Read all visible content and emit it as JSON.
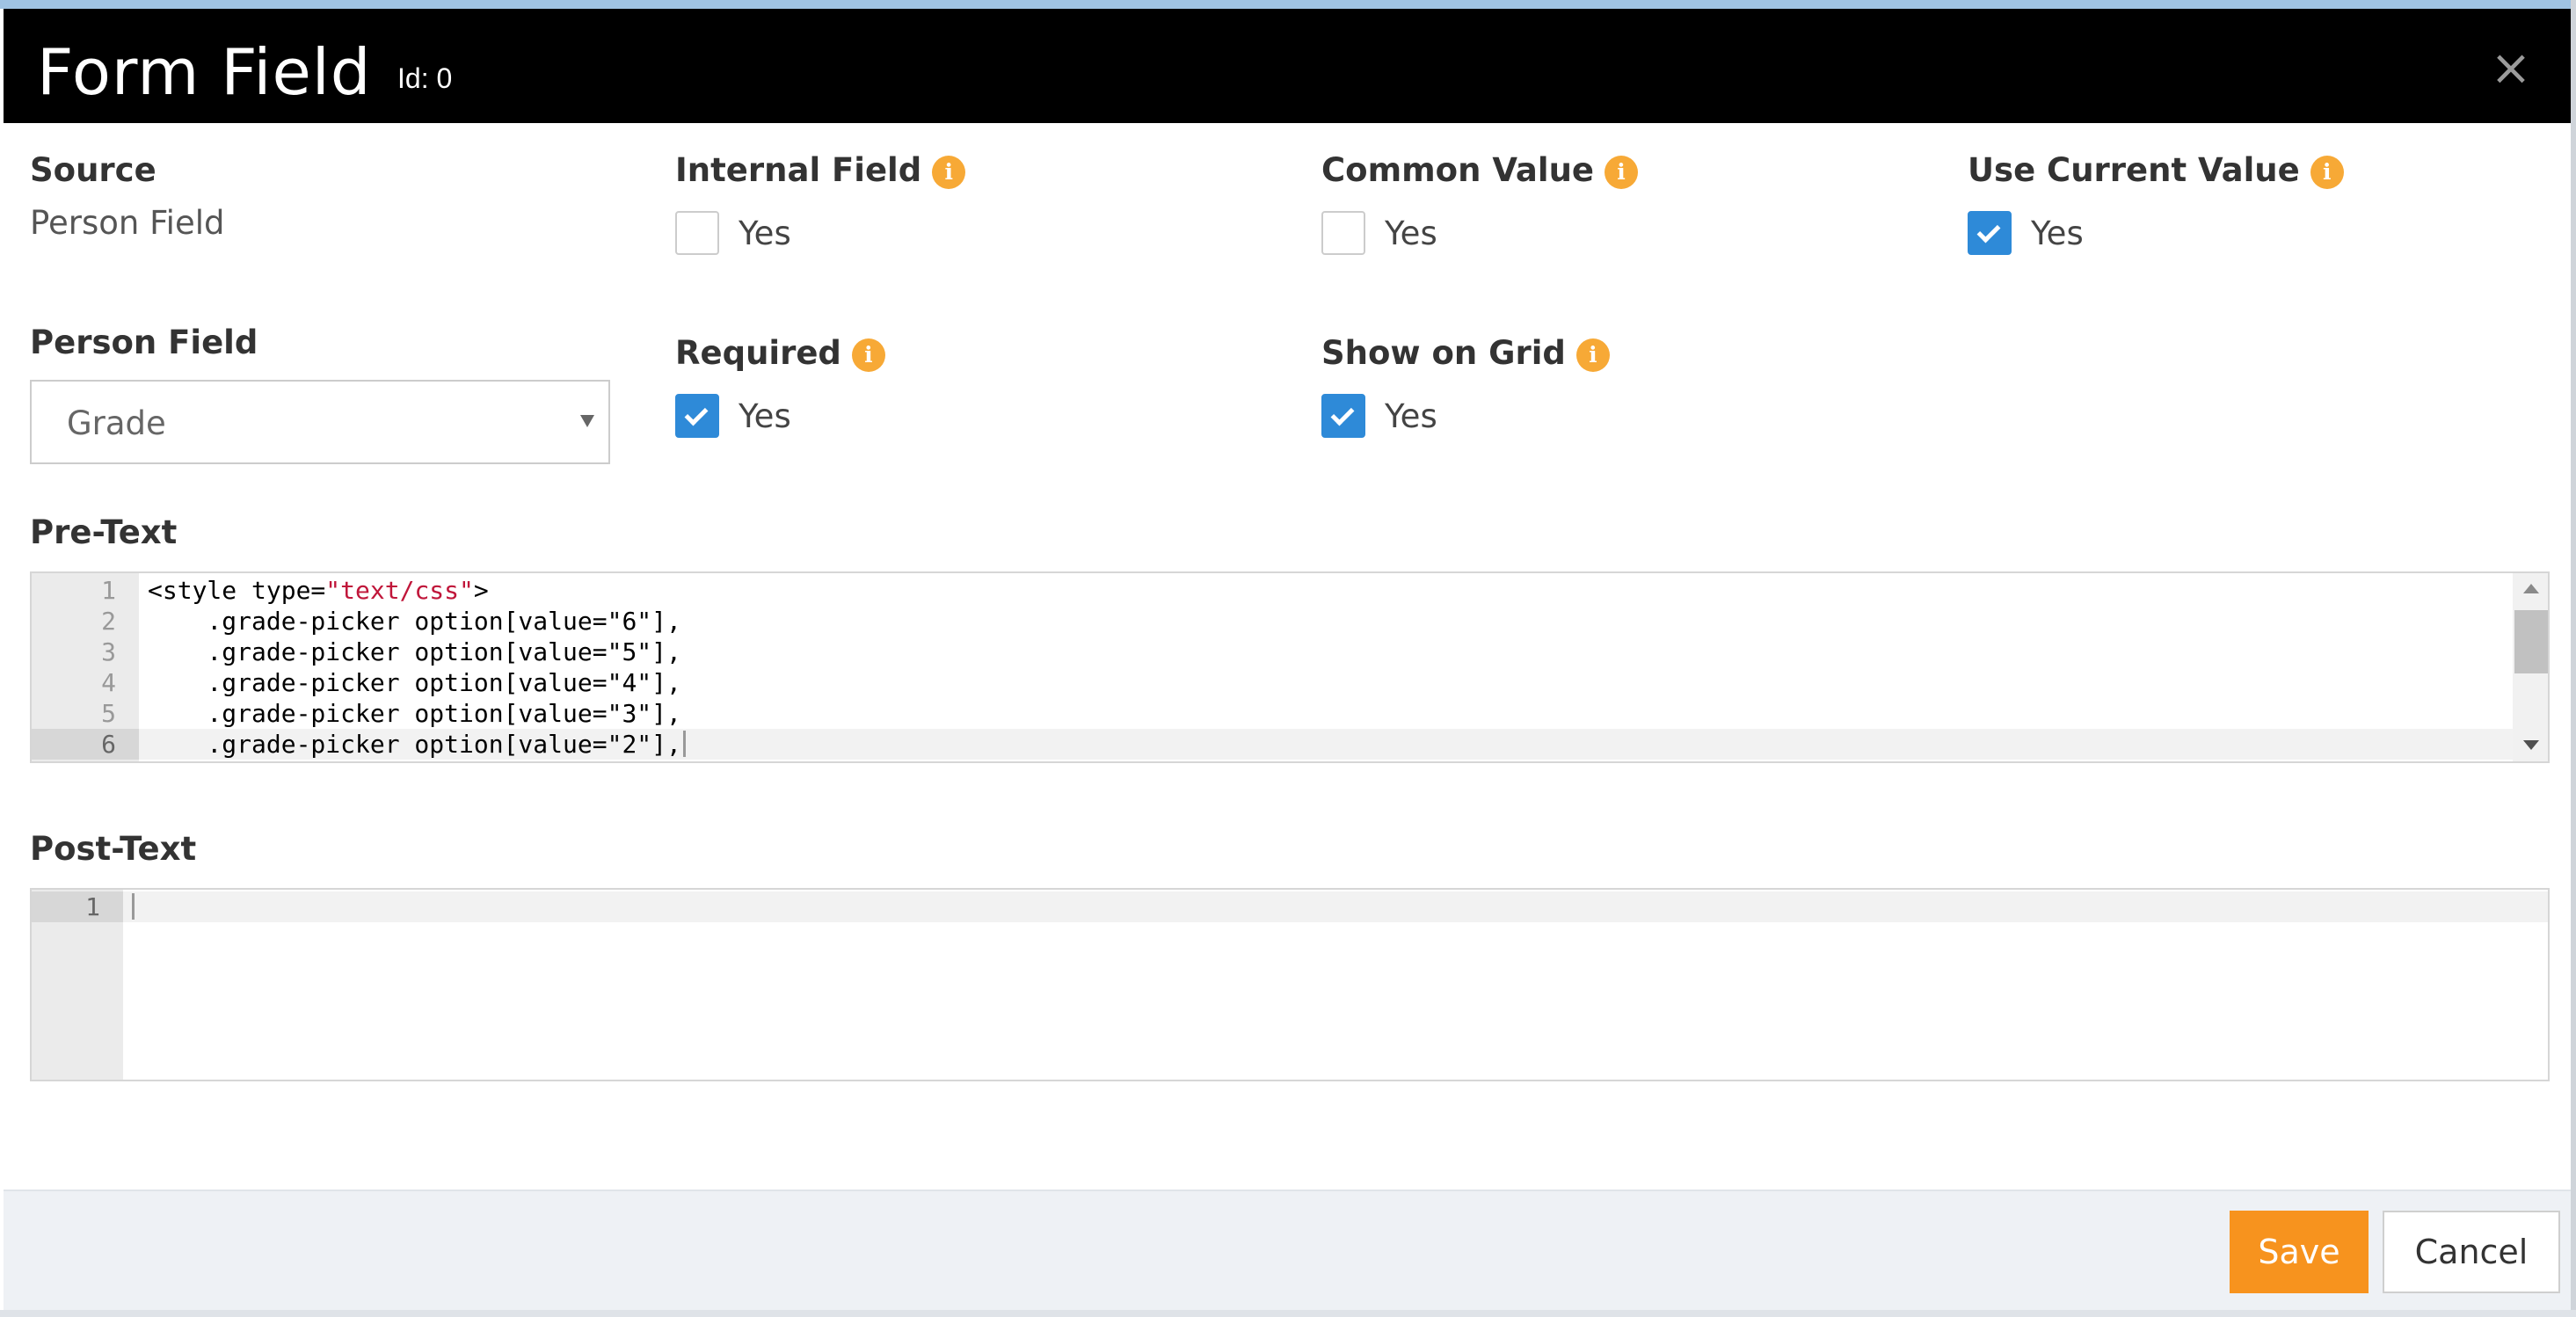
{
  "header": {
    "title": "Form Field",
    "id_label": "Id: 0",
    "close_symbol": "×"
  },
  "fields": {
    "source": {
      "label": "Source",
      "value": "Person Field"
    },
    "internal_field": {
      "label": "Internal Field",
      "checked": false,
      "option_label": "Yes"
    },
    "common_value": {
      "label": "Common Value",
      "checked": false,
      "option_label": "Yes"
    },
    "use_current_value": {
      "label": "Use Current Value",
      "checked": true,
      "option_label": "Yes"
    },
    "person_field": {
      "label": "Person Field",
      "selected": "Grade"
    },
    "required": {
      "label": "Required",
      "checked": true,
      "option_label": "Yes"
    },
    "show_on_grid": {
      "label": "Show on Grid",
      "checked": true,
      "option_label": "Yes"
    }
  },
  "pre_text": {
    "label": "Pre-Text",
    "lines": [
      {
        "n": "1",
        "text_before": "<style type=",
        "string": "\"text/css\"",
        "text_after": ">"
      },
      {
        "n": "2",
        "text": "    .grade-picker option[value=\"6\"],"
      },
      {
        "n": "3",
        "text": "    .grade-picker option[value=\"5\"],"
      },
      {
        "n": "4",
        "text": "    .grade-picker option[value=\"4\"],"
      },
      {
        "n": "5",
        "text": "    .grade-picker option[value=\"3\"],"
      },
      {
        "n": "6",
        "text": "    .grade-picker option[value=\"2\"],"
      }
    ]
  },
  "post_text": {
    "label": "Post-Text",
    "lines": [
      {
        "n": "1",
        "text": ""
      }
    ]
  },
  "footer": {
    "save_label": "Save",
    "cancel_label": "Cancel"
  },
  "icons": {
    "info": "i"
  },
  "colors": {
    "header_bg": "#000000",
    "checkbox_checked": "#2e8ad8",
    "info_badge": "#f7a936",
    "save_button": "#f7931e",
    "code_string": "#c0163a"
  }
}
